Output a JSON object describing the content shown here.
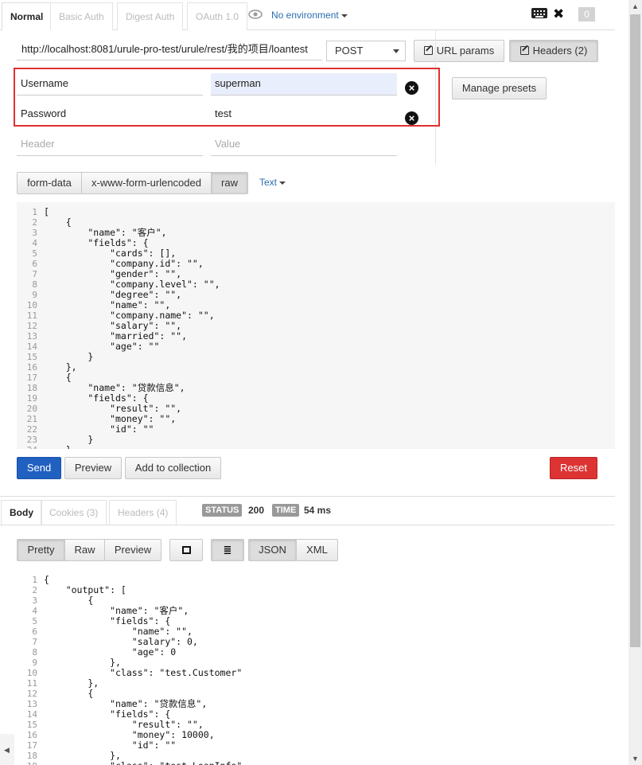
{
  "tabs": [
    "Normal",
    "Basic Auth",
    "Digest Auth",
    "OAuth 1.0"
  ],
  "environment": "No environment",
  "counter": "0",
  "request": {
    "url": "http://localhost:8081/urule-pro-test/urule/rest/我的项目/loantest",
    "method": "POST",
    "url_params_label": "URL params",
    "headers_label": "Headers (2)",
    "manage_presets_label": "Manage presets",
    "headers": [
      {
        "key": "Username",
        "value": "superman"
      },
      {
        "key": "Password",
        "value": "test"
      }
    ],
    "header_placeholder": "Header",
    "value_placeholder": "Value",
    "body_tabs": [
      "form-data",
      "x-www-form-urlencoded",
      "raw"
    ],
    "text_type": "Text",
    "body_lines": [
      "[",
      "    {",
      "        \"name\": \"客户\",",
      "        \"fields\": {",
      "            \"cards\": [],",
      "            \"company.id\": \"\",",
      "            \"gender\": \"\",",
      "            \"company.level\": \"\",",
      "            \"degree\": \"\",",
      "            \"name\": \"\",",
      "            \"company.name\": \"\",",
      "            \"salary\": \"\",",
      "            \"married\": \"\",",
      "            \"age\": \"\"",
      "        }",
      "    },",
      "    {",
      "        \"name\": \"贷款信息\",",
      "        \"fields\": {",
      "            \"result\": \"\",",
      "            \"money\": \"\",",
      "            \"id\": \"\"",
      "        }",
      "    }"
    ]
  },
  "actions": {
    "send": "Send",
    "preview": "Preview",
    "add_to_collection": "Add to collection",
    "reset": "Reset"
  },
  "response": {
    "tabs": [
      "Body",
      "Cookies (3)",
      "Headers (4)"
    ],
    "status_label": "STATUS",
    "status_value": "200",
    "time_label": "TIME",
    "time_value": "54 ms",
    "view_tabs": [
      "Pretty",
      "Raw",
      "Preview"
    ],
    "format_tabs": [
      "JSON",
      "XML"
    ],
    "body_lines": [
      "{",
      "    \"output\": [",
      "        {",
      "            \"name\": \"客户\",",
      "            \"fields\": {",
      "                \"name\": \"\",",
      "                \"salary\": 0,",
      "                \"age\": 0",
      "            },",
      "            \"class\": \"test.Customer\"",
      "        },",
      "        {",
      "            \"name\": \"贷款信息\",",
      "            \"fields\": {",
      "                \"result\": \"\",",
      "                \"money\": 10000,",
      "                \"id\": \"\"",
      "            },",
      "            \"class\": \"test.LoanInfo\""
    ]
  }
}
